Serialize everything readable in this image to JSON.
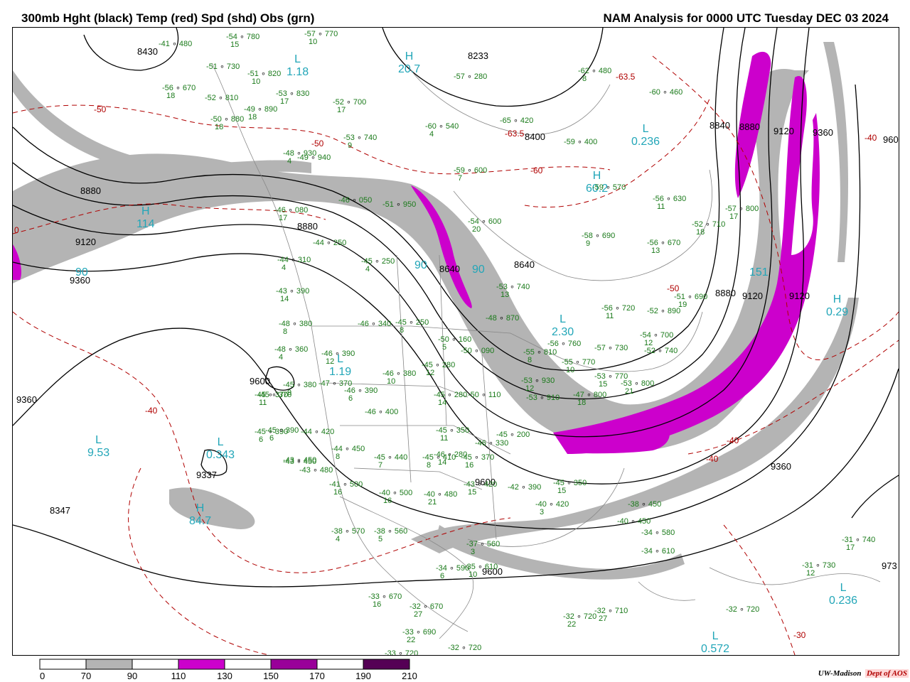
{
  "header": {
    "title_left": "300mb Hght (black) Temp (red) Spd (shd) Obs (grn)",
    "title_right": "NAM Analysis for 0000 UTC Tuesday  DEC 03 2024"
  },
  "colors": {
    "height": "#000000",
    "temp": "#b00000",
    "obs": "#1a7a1a",
    "pressure_label": "#22a6b8",
    "speed_70_90": "#b4b4b4",
    "speed_110_130": "#cc00cc",
    "speed_150_170": "#990099",
    "speed_190_210": "#550055",
    "boundaries": "#888888"
  },
  "height_labels": [
    "8430",
    "8233",
    "8400",
    "8640",
    "8840",
    "8880",
    "9120",
    "9360",
    "8880",
    "9120",
    "9360",
    "8640",
    "8880",
    "9120",
    "9360",
    "9600",
    "9337",
    "8347",
    "9600",
    "9360",
    "9600",
    "9600",
    "9600",
    "960",
    "973",
    "8880",
    "9120",
    "9360"
  ],
  "temp_labels": [
    "-50",
    "-50",
    "-63.5",
    "-60",
    "-63.5",
    "-40",
    "-40",
    "-40",
    "-40",
    "-30",
    "-50",
    "0",
    "-50"
  ],
  "pressure_centers": [
    {
      "letter": "L",
      "value": "1.18"
    },
    {
      "letter": "H",
      "value": "20.7"
    },
    {
      "letter": "L",
      "value": "0.236"
    },
    {
      "letter": "H",
      "value": "60.2"
    },
    {
      "letter": "L",
      "value": "1.19"
    },
    {
      "letter": "L",
      "value": "9.53"
    },
    {
      "letter": "L",
      "value": "0.343"
    },
    {
      "letter": "H",
      "value": "84.7"
    },
    {
      "letter": "L",
      "value": "2.30"
    },
    {
      "letter": "L",
      "value": "0.236"
    },
    {
      "letter": "L",
      "value": "0.572"
    },
    {
      "letter": "H",
      "value": "0.29"
    },
    {
      "letter": "H",
      "value": "114"
    },
    {
      "letter": "",
      "value": "90"
    },
    {
      "letter": "",
      "value": "90"
    },
    {
      "letter": "",
      "value": "90"
    },
    {
      "letter": "",
      "value": "151"
    }
  ],
  "observations": [
    {
      "t": "-54",
      "h": "780",
      "d": "15"
    },
    {
      "t": "-57",
      "h": "770",
      "d": "10"
    },
    {
      "t": "-41",
      "h": "480",
      "d": ""
    },
    {
      "t": "-51",
      "h": "730",
      "d": ""
    },
    {
      "t": "-51",
      "h": "820",
      "d": "10"
    },
    {
      "t": "-53",
      "h": "830",
      "d": "17"
    },
    {
      "t": "-56",
      "h": "670",
      "d": "18"
    },
    {
      "t": "-52",
      "h": "810",
      "d": ""
    },
    {
      "t": "-49",
      "h": "890",
      "d": "18"
    },
    {
      "t": "-50",
      "h": "880",
      "d": "18"
    },
    {
      "t": "-52",
      "h": "700",
      "d": "17"
    },
    {
      "t": "-57",
      "h": "280",
      "d": ""
    },
    {
      "t": "-62",
      "h": "480",
      "d": "8"
    },
    {
      "t": "-60",
      "h": "460",
      "d": ""
    },
    {
      "t": "-60",
      "h": "540",
      "d": "4"
    },
    {
      "t": "-65",
      "h": "420",
      "d": ""
    },
    {
      "t": "-59",
      "h": "400",
      "d": ""
    },
    {
      "t": "-53",
      "h": "740",
      "d": "9"
    },
    {
      "t": "-48",
      "h": "930",
      "d": "4"
    },
    {
      "t": "-49",
      "h": "940",
      "d": ""
    },
    {
      "t": "-59",
      "h": "600",
      "d": "7"
    },
    {
      "t": "-59",
      "h": "570",
      "d": ""
    },
    {
      "t": "-56",
      "h": "630",
      "d": "11"
    },
    {
      "t": "-46",
      "h": "050",
      "d": ""
    },
    {
      "t": "-51",
      "h": "950",
      "d": ""
    },
    {
      "t": "-46",
      "h": "080",
      "d": "17"
    },
    {
      "t": "-54",
      "h": "600",
      "d": "20"
    },
    {
      "t": "-52",
      "h": "710",
      "d": "18"
    },
    {
      "t": "-57",
      "h": "800",
      "d": "17"
    },
    {
      "t": "-58",
      "h": "690",
      "d": "9"
    },
    {
      "t": "-56",
      "h": "670",
      "d": "13"
    },
    {
      "t": "-44",
      "h": "250",
      "d": ""
    },
    {
      "t": "-45",
      "h": "250",
      "d": "4"
    },
    {
      "t": "-44",
      "h": "310",
      "d": "4"
    },
    {
      "t": "-43",
      "h": "390",
      "d": "14"
    },
    {
      "t": "-53",
      "h": "740",
      "d": "13"
    },
    {
      "t": "-56",
      "h": "720",
      "d": "11"
    },
    {
      "t": "-51",
      "h": "690",
      "d": "19"
    },
    {
      "t": "-52",
      "h": "890",
      "d": ""
    },
    {
      "t": "-48",
      "h": "380",
      "d": "8"
    },
    {
      "t": "-46",
      "h": "340",
      "d": ""
    },
    {
      "t": "-45",
      "h": "250",
      "d": "8"
    },
    {
      "t": "-48",
      "h": "870",
      "d": ""
    },
    {
      "t": "-54",
      "h": "700",
      "d": "12"
    },
    {
      "t": "-48",
      "h": "360",
      "d": "4"
    },
    {
      "t": "-46",
      "h": "390",
      "d": "12"
    },
    {
      "t": "-50",
      "h": "160",
      "d": "5"
    },
    {
      "t": "-50",
      "h": "090",
      "d": ""
    },
    {
      "t": "-55",
      "h": "810",
      "d": "8"
    },
    {
      "t": "-56",
      "h": "760",
      "d": ""
    },
    {
      "t": "-57",
      "h": "730",
      "d": ""
    },
    {
      "t": "-52",
      "h": "740",
      "d": ""
    },
    {
      "t": "-46",
      "h": "380",
      "d": "10"
    },
    {
      "t": "-45",
      "h": "280",
      "d": "12"
    },
    {
      "t": "-55",
      "h": "770",
      "d": "10"
    },
    {
      "t": "-53",
      "h": "770",
      "d": "15"
    },
    {
      "t": "-53",
      "h": "800",
      "d": "21"
    },
    {
      "t": "-45",
      "h": "380",
      "d": "9"
    },
    {
      "t": "-47",
      "h": "370",
      "d": ""
    },
    {
      "t": "-46",
      "h": "390",
      "d": "6"
    },
    {
      "t": "-45",
      "h": "370",
      "d": "11"
    },
    {
      "t": "-45",
      "h": "280",
      "d": "14"
    },
    {
      "t": "-50",
      "h": "110",
      "d": ""
    },
    {
      "t": "-53",
      "h": "930",
      "d": "12"
    },
    {
      "t": "-53",
      "h": "910",
      "d": ""
    },
    {
      "t": "-47",
      "h": "800",
      "d": "18"
    },
    {
      "t": "-46",
      "h": "400",
      "d": ""
    },
    {
      "t": "-45",
      "h": "390",
      "d": "6"
    },
    {
      "t": "-44",
      "h": "420",
      "d": ""
    },
    {
      "t": "-45",
      "h": "350",
      "d": "11"
    },
    {
      "t": "-46",
      "h": "330",
      "d": ""
    },
    {
      "t": "-45",
      "h": "200",
      "d": ""
    },
    {
      "t": "-46",
      "h": "280",
      "d": "14"
    },
    {
      "t": "-43",
      "h": "450",
      "d": ""
    },
    {
      "t": "-44",
      "h": "450",
      "d": "8"
    },
    {
      "t": "-45",
      "h": "440",
      "d": "7"
    },
    {
      "t": "-45",
      "h": "410",
      "d": "8"
    },
    {
      "t": "-45",
      "h": "370",
      "d": "16"
    },
    {
      "t": "-41",
      "h": "500",
      "d": "16"
    },
    {
      "t": "-40",
      "h": "500",
      "d": "16"
    },
    {
      "t": "-40",
      "h": "480",
      "d": "21"
    },
    {
      "t": "-43",
      "h": "420",
      "d": "15"
    },
    {
      "t": "-42",
      "h": "390",
      "d": ""
    },
    {
      "t": "-45",
      "h": "350",
      "d": "15"
    },
    {
      "t": "-40",
      "h": "420",
      "d": "3"
    },
    {
      "t": "-38",
      "h": "450",
      "d": ""
    },
    {
      "t": "-40",
      "h": "450",
      "d": ""
    },
    {
      "t": "-38",
      "h": "570",
      "d": "4"
    },
    {
      "t": "-38",
      "h": "560",
      "d": "5"
    },
    {
      "t": "-37",
      "h": "560",
      "d": "3"
    },
    {
      "t": "-34",
      "h": "590",
      "d": "6"
    },
    {
      "t": "-35",
      "h": "610",
      "d": "10"
    },
    {
      "t": "-34",
      "h": "580",
      "d": ""
    },
    {
      "t": "-34",
      "h": "610",
      "d": ""
    },
    {
      "t": "-33",
      "h": "670",
      "d": "16"
    },
    {
      "t": "-32",
      "h": "670",
      "d": "27"
    },
    {
      "t": "-33",
      "h": "690",
      "d": "22"
    },
    {
      "t": "-33",
      "h": "720",
      "d": ""
    },
    {
      "t": "-32",
      "h": "720",
      "d": ""
    },
    {
      "t": "-32",
      "h": "720",
      "d": "22"
    },
    {
      "t": "-32",
      "h": "710",
      "d": "27"
    },
    {
      "t": "-32",
      "h": "720",
      "d": ""
    },
    {
      "t": "-31",
      "h": "730",
      "d": "12"
    },
    {
      "t": "-31",
      "h": "740",
      "d": "17"
    },
    {
      "t": "-45",
      "h": "370",
      "d": ""
    },
    {
      "t": "-45",
      "h": "390",
      "d": "6"
    },
    {
      "t": "-43",
      "h": "450",
      "d": ""
    },
    {
      "t": "-43",
      "h": "480",
      "d": ""
    }
  ],
  "colorbar": {
    "labels": [
      "0",
      "70",
      "90",
      "110",
      "130",
      "150",
      "170",
      "190",
      "210"
    ],
    "fills": [
      "#ffffff",
      "#b4b4b4",
      "#ffffff",
      "#cc00cc",
      "#ffffff",
      "#990099",
      "#ffffff",
      "#550055"
    ]
  },
  "footer": {
    "logo_main": "UW-Madison",
    "logo_dept": "Dept of AOS"
  }
}
